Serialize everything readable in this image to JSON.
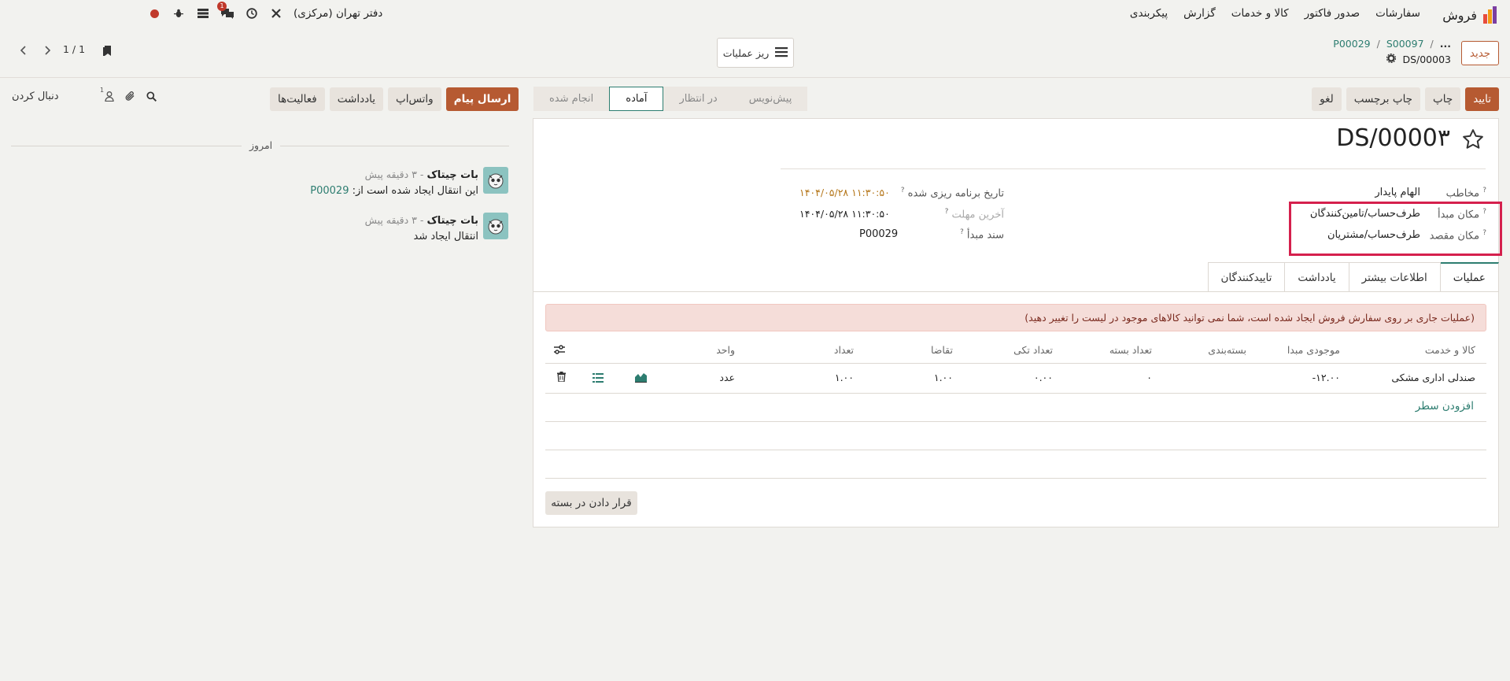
{
  "navbar": {
    "app_name": "فروش",
    "menu": [
      "سفارشات",
      "صدور فاکتور",
      "کالا و خدمات",
      "گزارش",
      "پیکربندی"
    ],
    "company": "دفتر تهران (مرکزی)",
    "chat_badge": "1"
  },
  "control": {
    "new_label": "جدید",
    "breadcrumb": [
      "...",
      "S00097",
      "P00029"
    ],
    "record_name": "DS/00003",
    "ops_toggle_label": "ریز عملیات",
    "pager": "1 / 1"
  },
  "statusbar": {
    "buttons": [
      "تایید",
      "چاپ",
      "چاپ برچسب",
      "لغو"
    ],
    "stages": [
      "پیش‌نویس",
      "در انتظار",
      "آماده",
      "انجام شده"
    ],
    "active_stage": "آماده"
  },
  "form": {
    "title": "DS/0000۳",
    "fields_right": [
      {
        "label": "مخاطب",
        "value": "الهام پایدار"
      },
      {
        "label": "مکان مبدأ",
        "value": "طرف‌حساب/تامین‌کنندگان"
      },
      {
        "label": "مکان مقصد",
        "value": "طرف‌حساب/مشتریان"
      }
    ],
    "fields_left": [
      {
        "label": "تاریخ برنامه ریزی شده",
        "value": "۱۴۰۴/۰۵/۲۸ ۱۱:۳۰:۵۰"
      },
      {
        "label": "آخرین مهلت",
        "value": "۱۴۰۴/۰۵/۲۸ ۱۱:۳۰:۵۰"
      },
      {
        "label": "سند مبدأ",
        "value": "P00029"
      }
    ],
    "tabs": [
      "عملیات",
      "اطلاعات بیشتر",
      "یادداشت",
      "تاییدکنندگان"
    ],
    "alert": "(عملیات جاری بر روی سفارش فروش ایجاد شده است، شما نمی توانید کالاهای موجود در لیست را تغییر دهید)",
    "table": {
      "headers": [
        "کالا و خدمت",
        "موجودی مبدا",
        "بسته‌بندی",
        "تعداد بسته",
        "تعداد تکی",
        "تقاضا",
        "تعداد",
        "واحد"
      ],
      "row": [
        "صندلی اداری مشکی",
        "-۱۲.۰۰",
        "",
        "۰",
        "۰.۰۰",
        "۱.۰۰",
        "۱.۰۰",
        "عدد"
      ]
    },
    "add_line": "افزودن سطر",
    "pack_button": "قرار دادن در بسته"
  },
  "chatter": {
    "buttons": [
      "ارسال پیام",
      "واتس‌اپ",
      "یادداشت",
      "فعالیت‌ها"
    ],
    "follower_count": "1",
    "follow_label": "دنبال کردن",
    "today_label": "امروز",
    "messages": [
      {
        "author": "بات چیتاک",
        "time": "- ۳ دقیقه پیش",
        "text": "این انتقال ایجاد شده است از:",
        "link": "P00029"
      },
      {
        "author": "بات چیتاک",
        "time": "- ۳ دقیقه پیش",
        "text": "انتقال ایجاد شد",
        "link": ""
      }
    ]
  },
  "colors": {
    "primary": "#b65a32",
    "accent": "#2d7d70",
    "highlight": "#d5204d",
    "date_orange": "#b5771b"
  }
}
